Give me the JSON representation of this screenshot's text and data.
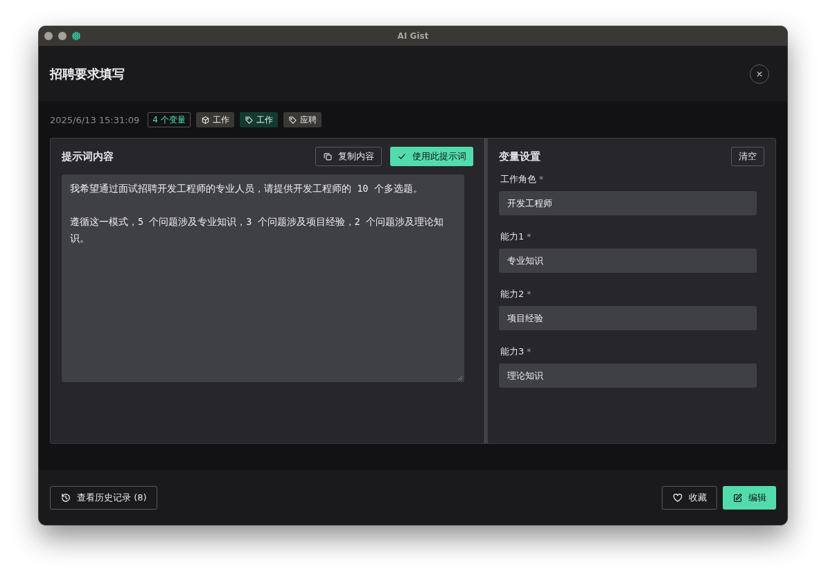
{
  "window": {
    "title": "AI Gist"
  },
  "dialog": {
    "title": "招聘要求填写"
  },
  "meta": {
    "timestamp": "2025/6/13 15:31:09",
    "variable_count": "4 个变量",
    "tags": [
      {
        "kind": "category",
        "label": "工作",
        "color": "#3a3835"
      },
      {
        "kind": "tag",
        "label": "工作",
        "color": "#133a2e"
      },
      {
        "kind": "tag",
        "label": "应聘",
        "color": "#3a3835"
      }
    ]
  },
  "prompt_panel": {
    "title": "提示词内容",
    "copy_button": "复制内容",
    "use_button": "使用此提示词",
    "paragraphs": [
      "我希望通过面试招聘开发工程师的专业人员，请提供开发工程师的 10 个多选题。",
      "遵循这一模式，5 个问题涉及专业知识，3 个问题涉及项目经验，2 个问题涉及理论知识。"
    ]
  },
  "variables_panel": {
    "title": "变量设置",
    "clear_button": "清空",
    "variables": [
      {
        "label": "工作角色",
        "marker": "*",
        "value": "开发工程师"
      },
      {
        "label": "能力1",
        "marker": "*",
        "value": "专业知识"
      },
      {
        "label": "能力2",
        "marker": "*",
        "value": "项目经验"
      },
      {
        "label": "能力3",
        "marker": "*",
        "value": "理论知识"
      }
    ]
  },
  "footer": {
    "history_button": "查看历史记录 (8)",
    "favorite_button": "收藏",
    "edit_button": "编辑"
  }
}
